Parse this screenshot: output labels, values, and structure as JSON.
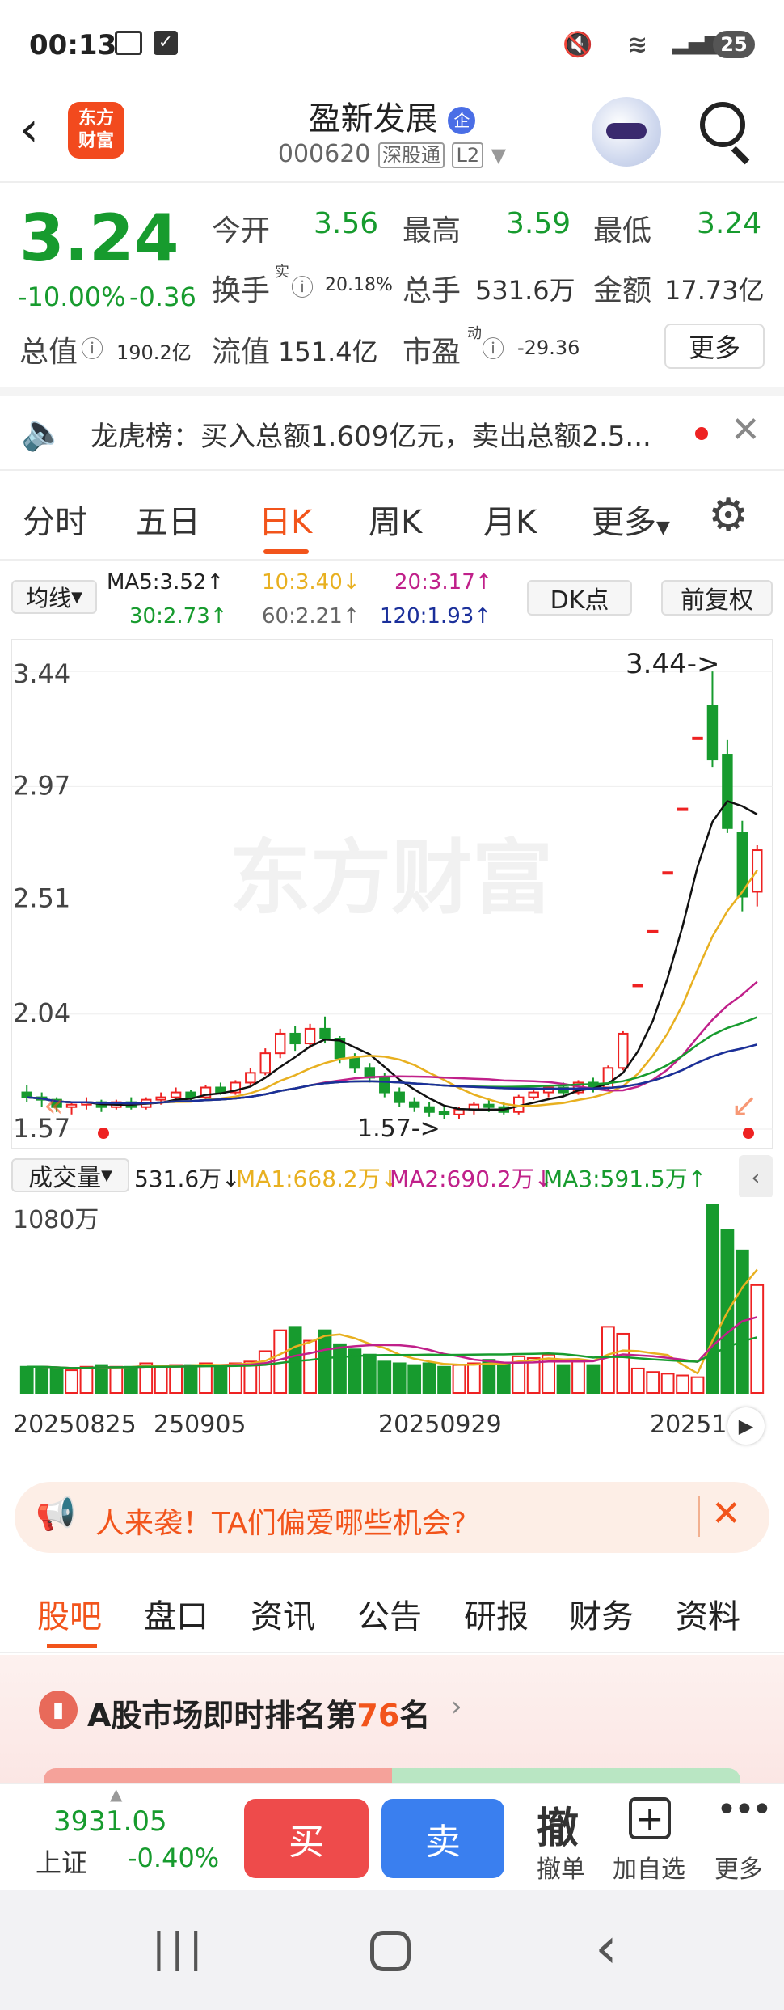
{
  "status": {
    "time": "00:13",
    "battery": "25"
  },
  "header": {
    "back": "back",
    "logo": "东方\n财富",
    "name": "盈新发展",
    "badge": "企",
    "code": "000620",
    "exchange_tag": "深股通",
    "level_tag": "L2"
  },
  "quote": {
    "price": "3.24",
    "change_pct": "-10.00%",
    "change_abs": "-0.36",
    "open_label": "今开",
    "open": "3.56",
    "high_label": "最高",
    "high": "3.59",
    "low_label": "最低",
    "low": "3.24",
    "turnover_label": "换手",
    "turnover_sup": "实",
    "turnover": "20.18%",
    "vol_label": "总手",
    "vol": "531.6万",
    "amount_label": "金额",
    "amount": "17.73亿",
    "mcap_label": "总值",
    "mcap": "190.2亿",
    "float_label": "流值",
    "float": "151.4亿",
    "pe_label": "市盈",
    "pe_sup": "动",
    "pe": "-29.36",
    "more": "更多"
  },
  "notice": {
    "text": "龙虎榜：买入总额1.609亿元，卖出总额2.5..."
  },
  "tabs": [
    "分时",
    "五日",
    "日K",
    "周K",
    "月K",
    "更多"
  ],
  "ma": {
    "selector": "均线",
    "ma5": "MA5:3.52↑",
    "ma10": "10:3.40↓",
    "ma20": "20:3.17↑",
    "ma30": "30:2.73↑",
    "ma60": "60:2.21↑",
    "ma120": "120:1.93↑",
    "dk": "DK点",
    "adjust": "前复权"
  },
  "chart_data": {
    "type": "candlestick",
    "y_ticks": [
      "3.44",
      "2.97",
      "2.51",
      "2.04",
      "1.57"
    ],
    "max_label": "3.44->",
    "min_label": "1.57->",
    "watermark": "东方财富",
    "x_ticks": [
      "20250825",
      "250905",
      "20250929",
      "20251"
    ],
    "candles": [
      [
        1.72,
        1.7,
        1.75,
        1.68
      ],
      [
        1.7,
        1.69,
        1.72,
        1.66
      ],
      [
        1.69,
        1.66,
        1.7,
        1.64
      ],
      [
        1.66,
        1.67,
        1.68,
        1.63
      ],
      [
        1.67,
        1.68,
        1.7,
        1.65
      ],
      [
        1.68,
        1.66,
        1.69,
        1.64
      ],
      [
        1.66,
        1.68,
        1.69,
        1.65
      ],
      [
        1.68,
        1.66,
        1.7,
        1.65
      ],
      [
        1.66,
        1.69,
        1.7,
        1.65
      ],
      [
        1.69,
        1.7,
        1.72,
        1.67
      ],
      [
        1.7,
        1.72,
        1.74,
        1.69
      ],
      [
        1.72,
        1.7,
        1.73,
        1.68
      ],
      [
        1.7,
        1.74,
        1.75,
        1.69
      ],
      [
        1.74,
        1.72,
        1.76,
        1.71
      ],
      [
        1.72,
        1.76,
        1.77,
        1.71
      ],
      [
        1.76,
        1.8,
        1.82,
        1.75
      ],
      [
        1.8,
        1.88,
        1.9,
        1.79
      ],
      [
        1.88,
        1.96,
        1.98,
        1.86
      ],
      [
        1.96,
        1.92,
        1.99,
        1.89
      ],
      [
        1.92,
        1.98,
        2.0,
        1.9
      ],
      [
        1.98,
        1.94,
        2.03,
        1.92
      ],
      [
        1.94,
        1.86,
        1.95,
        1.84
      ],
      [
        1.86,
        1.82,
        1.88,
        1.8
      ],
      [
        1.82,
        1.78,
        1.84,
        1.76
      ],
      [
        1.78,
        1.72,
        1.8,
        1.7
      ],
      [
        1.72,
        1.68,
        1.74,
        1.66
      ],
      [
        1.68,
        1.66,
        1.7,
        1.64
      ],
      [
        1.66,
        1.64,
        1.68,
        1.62
      ],
      [
        1.64,
        1.63,
        1.66,
        1.61
      ],
      [
        1.63,
        1.65,
        1.66,
        1.61
      ],
      [
        1.65,
        1.67,
        1.68,
        1.63
      ],
      [
        1.67,
        1.66,
        1.69,
        1.64
      ],
      [
        1.66,
        1.64,
        1.68,
        1.63
      ],
      [
        1.64,
        1.7,
        1.71,
        1.63
      ],
      [
        1.7,
        1.72,
        1.74,
        1.69
      ],
      [
        1.72,
        1.74,
        1.75,
        1.7
      ],
      [
        1.74,
        1.72,
        1.76,
        1.7
      ],
      [
        1.72,
        1.76,
        1.77,
        1.71
      ],
      [
        1.76,
        1.74,
        1.78,
        1.72
      ],
      [
        1.74,
        1.82,
        1.83,
        1.73
      ],
      [
        1.82,
        1.96,
        1.97,
        1.81
      ],
      [
        2.16,
        2.16,
        2.16,
        2.16
      ],
      [
        2.38,
        2.38,
        2.38,
        2.38
      ],
      [
        2.62,
        2.62,
        2.62,
        2.62
      ],
      [
        2.88,
        2.88,
        2.88,
        2.88
      ],
      [
        3.17,
        3.17,
        3.17,
        3.17
      ],
      [
        3.3,
        3.08,
        3.44,
        3.05
      ],
      [
        3.1,
        2.8,
        3.16,
        2.78
      ],
      [
        2.78,
        2.52,
        2.83,
        2.46
      ],
      [
        2.54,
        2.71,
        2.73,
        2.48
      ]
    ]
  },
  "volume": {
    "selector": "成交量",
    "value": "531.6万↓",
    "ma1": "MA1:668.2万↓",
    "ma2": "MA2:690.2万↓",
    "ma3": "MA3:591.5万↑",
    "top": "1080万",
    "bars": [
      150,
      150,
      140,
      130,
      150,
      160,
      150,
      150,
      170,
      150,
      160,
      160,
      170,
      160,
      170,
      180,
      240,
      360,
      380,
      300,
      360,
      280,
      250,
      220,
      180,
      170,
      160,
      170,
      150,
      160,
      170,
      190,
      170,
      210,
      200,
      220,
      160,
      180,
      160,
      380,
      340,
      140,
      120,
      110,
      100,
      90,
      1080,
      940,
      820,
      620
    ]
  },
  "promo": {
    "text": "人来袭！TA们偏爱哪些机会?"
  },
  "subtabs": [
    "股吧",
    "盘口",
    "资讯",
    "公告",
    "研报",
    "财务",
    "资料"
  ],
  "rank": {
    "prefix": "A股市场即时排名第",
    "num": "76",
    "suffix": "名"
  },
  "bottom": {
    "index_val": "3931.05",
    "index_name": "上证",
    "index_chg": "-0.40%",
    "buy": "买",
    "sell": "卖",
    "cancel": "撤",
    "cancel_label": "撤单",
    "add_label": "加自选",
    "more_label": "更多"
  }
}
